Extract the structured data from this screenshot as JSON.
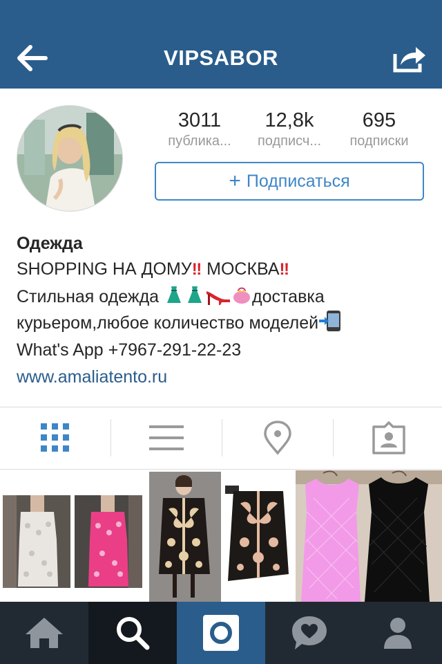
{
  "header": {
    "title": "VIPSABOR",
    "back_icon": "arrow-left-icon",
    "share_icon": "share-icon",
    "background": "#2a5d8c"
  },
  "profile": {
    "stats": [
      {
        "value": "3011",
        "label": "публика..."
      },
      {
        "value": "12,8k",
        "label": "подписч..."
      },
      {
        "value": "695",
        "label": "подписки"
      }
    ],
    "follow_button": "Подписаться",
    "follow_plus": "+",
    "accent": "#3f86c7"
  },
  "bio": {
    "name": "Одежда",
    "line1_text": "SHOPPING НА ДОМУ",
    "line1_city": " МОСКВА",
    "line2_text": "Стильная одежда ",
    "line2_delivery": "доставка",
    "line3_text": "курьером,любое количество моделей",
    "line4_text": "What's App +7967-291-22-23",
    "link": "www.amaliatento.ru",
    "link_color": "#2a5d8c"
  },
  "view_tabs": [
    {
      "icon": "grid-icon",
      "active": true
    },
    {
      "icon": "list-icon",
      "active": false
    },
    {
      "icon": "location-pin-icon",
      "active": false
    },
    {
      "icon": "tagged-photos-icon",
      "active": false
    }
  ],
  "bottom_nav": [
    {
      "icon": "home-icon"
    },
    {
      "icon": "search-icon",
      "active": true
    },
    {
      "icon": "camera-icon"
    },
    {
      "icon": "activity-heart-icon"
    },
    {
      "icon": "profile-icon"
    }
  ]
}
